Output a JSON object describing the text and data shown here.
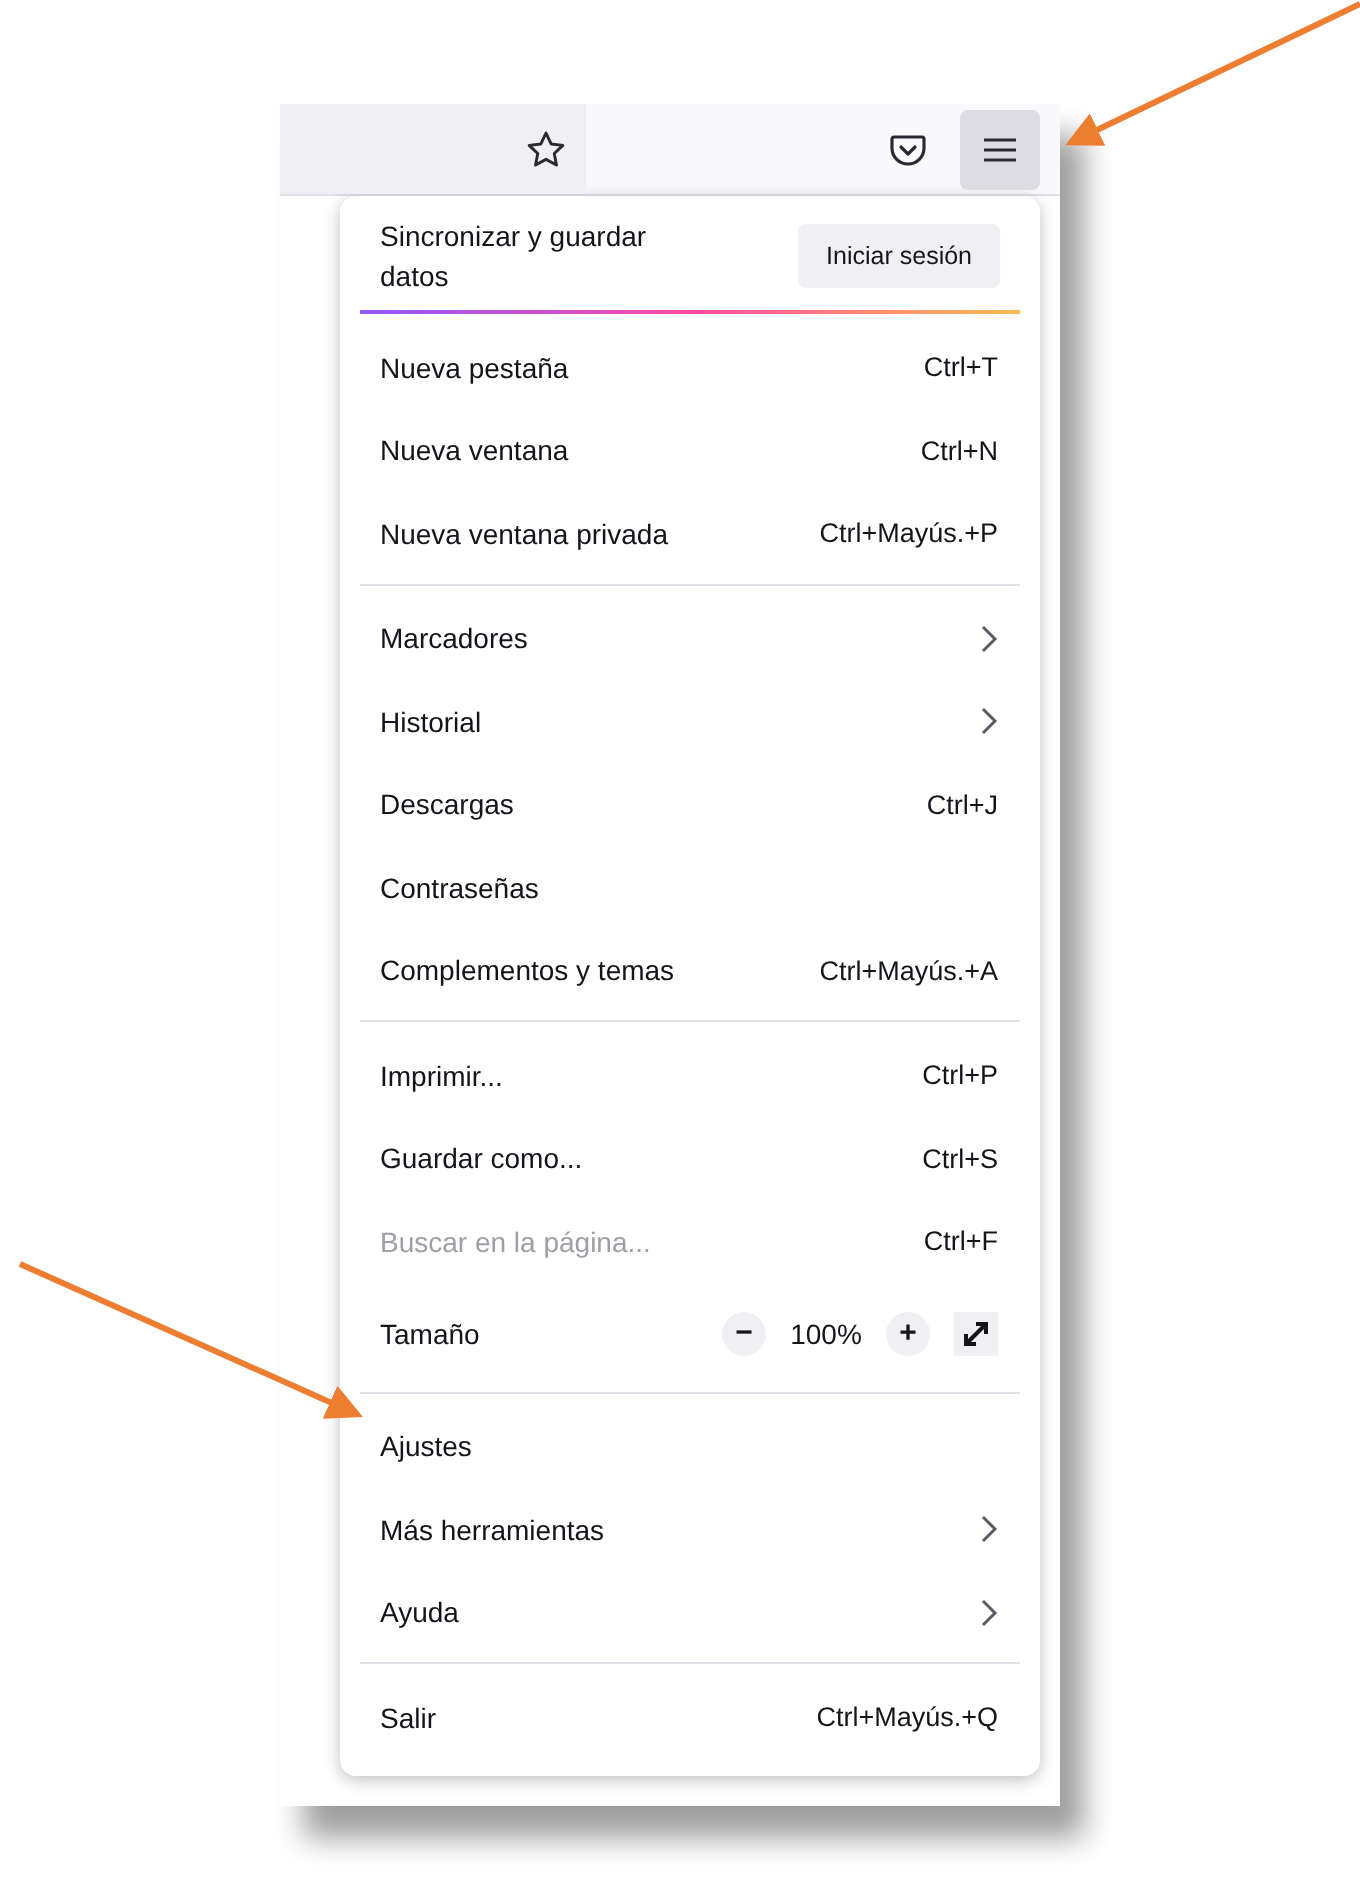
{
  "toolbar": {
    "menu_button": {
      "selected": true
    }
  },
  "sync": {
    "label": "Sincronizar y guardar datos",
    "button": "Iniciar sesión"
  },
  "sections": [
    {
      "items": [
        {
          "kind": "item",
          "label": "Nueva pestaña",
          "shortcut": "Ctrl+T",
          "disabled": false
        },
        {
          "kind": "item",
          "label": "Nueva ventana",
          "shortcut": "Ctrl+N",
          "disabled": false
        },
        {
          "kind": "item",
          "label": "Nueva ventana privada",
          "shortcut": "Ctrl+Mayús.+P",
          "disabled": false
        }
      ]
    },
    {
      "items": [
        {
          "kind": "submenu",
          "label": "Marcadores",
          "disabled": false
        },
        {
          "kind": "submenu",
          "label": "Historial",
          "disabled": false
        },
        {
          "kind": "item",
          "label": "Descargas",
          "shortcut": "Ctrl+J",
          "disabled": false
        },
        {
          "kind": "item",
          "label": "Contraseñas",
          "disabled": false
        },
        {
          "kind": "item",
          "label": "Complementos y temas",
          "shortcut": "Ctrl+Mayús.+A",
          "disabled": false
        }
      ]
    },
    {
      "items": [
        {
          "kind": "item",
          "label": "Imprimir...",
          "shortcut": "Ctrl+P",
          "disabled": false
        },
        {
          "kind": "item",
          "label": "Guardar como...",
          "shortcut": "Ctrl+S",
          "disabled": false
        },
        {
          "kind": "item",
          "label": "Buscar en la página...",
          "shortcut": "Ctrl+F",
          "disabled": true
        },
        {
          "kind": "zoom",
          "label": "Tamaño",
          "minus": "−",
          "value": "100%",
          "plus": "+"
        }
      ]
    },
    {
      "items": [
        {
          "kind": "item",
          "label": "Ajustes",
          "disabled": false
        },
        {
          "kind": "submenu",
          "label": "Más herramientas",
          "disabled": false
        },
        {
          "kind": "submenu",
          "label": "Ayuda",
          "disabled": false
        }
      ]
    },
    {
      "items": [
        {
          "kind": "item",
          "label": "Salir",
          "shortcut": "Ctrl+Mayús.+Q",
          "disabled": false
        }
      ]
    }
  ]
}
